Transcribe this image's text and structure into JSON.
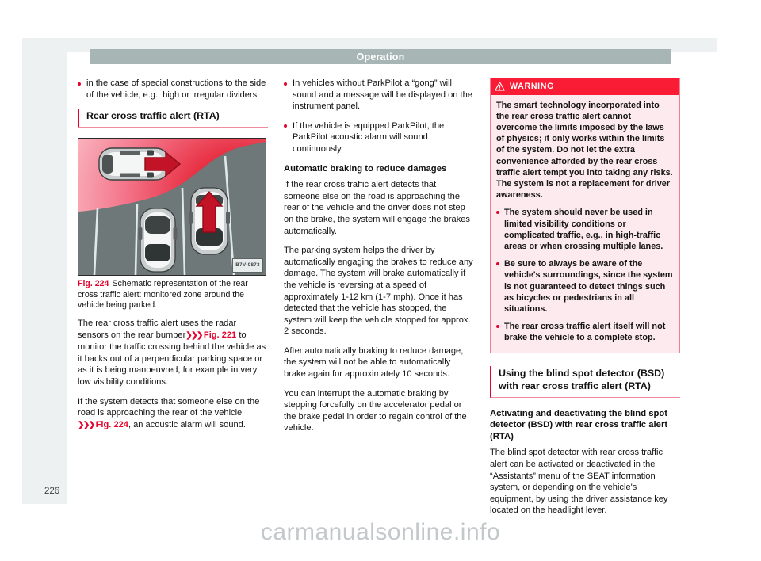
{
  "header": {
    "title": "Operation"
  },
  "page_number": "226",
  "watermark": "carmanualsonline.info",
  "column_left": {
    "bullet_1": "in the case of special constructions to the side of the vehicle, e.g., high or irregular dividers",
    "section_heading": "Rear cross traffic alert (RTA)",
    "figure": {
      "code": "B7V-0873",
      "number": "Fig. 224",
      "caption": "Schematic representation of the rear cross traffic alert: monitored zone around the vehicle being parked."
    },
    "para_1_before": "The rear cross traffic alert uses the radar sensors on the rear bumper",
    "para_1_xref": "Fig. 221",
    "para_1_after": "to monitor the traffic crossing behind the vehicle as it backs out of a perpendicular parking space or as it is being manoeuvred, for example in very low visibility conditions.",
    "para_2_before": "If the system detects that someone else on the road is approaching the rear of the vehicle",
    "para_2_xref": "Fig. 224",
    "para_2_after": ", an acoustic alarm will sound."
  },
  "column_middle": {
    "bullet_1": "In vehicles without ParkPilot a “gong” will sound and a message will be displayed on the instrument panel.",
    "bullet_2": "If the vehicle is equipped ParkPilot, the ParkPilot acoustic alarm will sound continuously.",
    "sub_heading": "Automatic braking to reduce damages",
    "para_1": "If the rear cross traffic alert detects that someone else on the road is approaching the rear of the vehicle and the driver does not step on the brake, the system will engage the brakes automatically.",
    "para_2": "The parking system helps the driver by automatically engaging the brakes to reduce any damage. The system will brake automatically if the vehicle is reversing at a speed of approximately 1-12 km (1-7 mph). Once it has detected that the vehicle has stopped, the system will keep the vehicle stopped for approx. 2 seconds.",
    "para_3": "After automatically braking to reduce damage, the system will not be able to automatically brake again for approximately 10 seconds.",
    "para_4": "You can interrupt the automatic braking by stepping forcefully on the accelerator pedal or the brake pedal in order to regain control of the vehicle."
  },
  "column_right": {
    "warning": {
      "label": "WARNING",
      "para_1": "The smart technology incorporated into the rear cross traffic alert cannot overcome the limits imposed by the laws of physics; it only works within the limits of the system. Do not let the extra convenience afforded by the rear cross traffic alert tempt you into taking any risks. The system is not a replacement for driver awareness.",
      "bullet_1": "The system should never be used in limited visibility conditions or complicated traffic, e.g., in high-traffic areas or when crossing multiple lanes.",
      "bullet_2": "Be sure to always be aware of the vehicle's surroundings, since the system is not guaranteed to detect things such as bicycles or pedestrians in all situations.",
      "bullet_3": "The rear cross traffic alert itself will not brake the vehicle to a complete stop."
    },
    "section_heading": "Using the blind spot detector (BSD) with rear cross traffic alert (RTA)",
    "sub_heading": "Activating and deactivating the blind spot detector (BSD) with rear cross traffic alert (RTA)",
    "para_1": "The blind spot detector with rear cross traffic alert can be activated or deactivated in the “Assistants” menu of the SEAT information system, or depending on the vehicle's equipment, by using the driver assistance key located on the headlight lever."
  },
  "colors": {
    "accent_red": "#e4032e",
    "warning_red": "#fa1c34",
    "header_gray": "#a7b6b5",
    "page_bg": "#edf1f2"
  }
}
